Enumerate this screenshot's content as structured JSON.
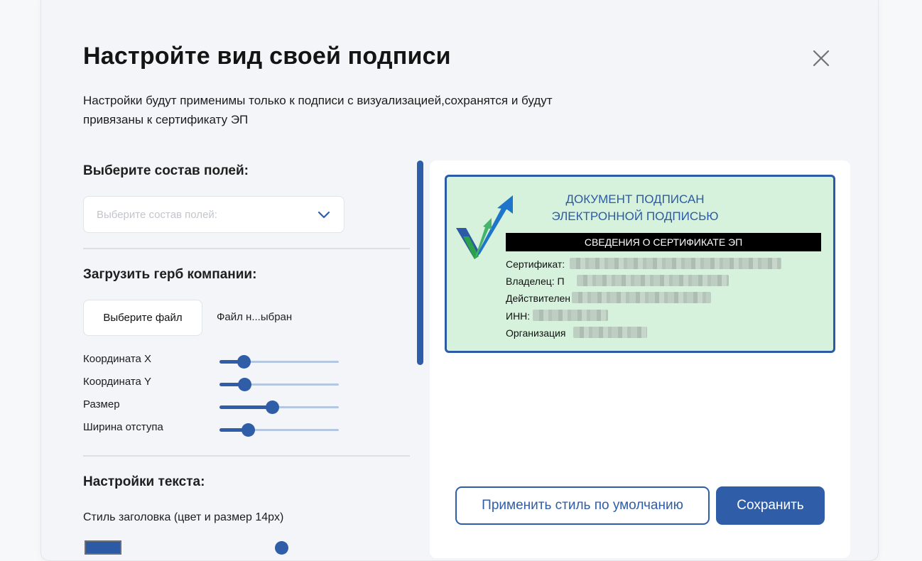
{
  "modal": {
    "title": "Настройте вид своей подписи",
    "subtitle_line1": "Настройки будут применимы только к подписи с визуализацией,сохранятся и будут",
    "subtitle_line2": "привязаны к сертификату ЭП",
    "close_icon": "close-icon"
  },
  "fields_section": {
    "heading": "Выберите состав полей:",
    "select_placeholder": "Выберите состав полей:"
  },
  "coat_section": {
    "heading": "Загрузить герб компании:",
    "file_button": "Выберите файл",
    "file_status": "Файл н...ыбран"
  },
  "sliders": [
    {
      "label": "Координата X",
      "value": 0.2
    },
    {
      "label": "Координата Y",
      "value": 0.21
    },
    {
      "label": "Размер",
      "value": 0.44
    },
    {
      "label": "Ширина отступа",
      "value": 0.24
    }
  ],
  "text_section": {
    "heading": "Настройки текста:",
    "style_label": "Стиль заголовка (цвет и размер 14px)",
    "color": "#2d5aa5"
  },
  "stamp": {
    "title_line1": "ДОКУМЕНТ ПОДПИСАН",
    "title_line2": "ЭЛЕКТРОННОЙ ПОДПИСЬЮ",
    "bar_text": "СВЕДЕНИЯ О СЕРТИФИКАТЕ ЭП",
    "certificate_label": "Сертификат:",
    "owner_label": "Владелец: П",
    "valid_label": "Действителен",
    "inn_label": "ИНН:",
    "org_label": "Организация",
    "background": "#d6f2dc",
    "border": "#2c5aa5"
  },
  "actions": {
    "default_style": "Применить стиль по умолчанию",
    "save": "Сохранить"
  },
  "colors": {
    "accent": "#2f5da7"
  }
}
